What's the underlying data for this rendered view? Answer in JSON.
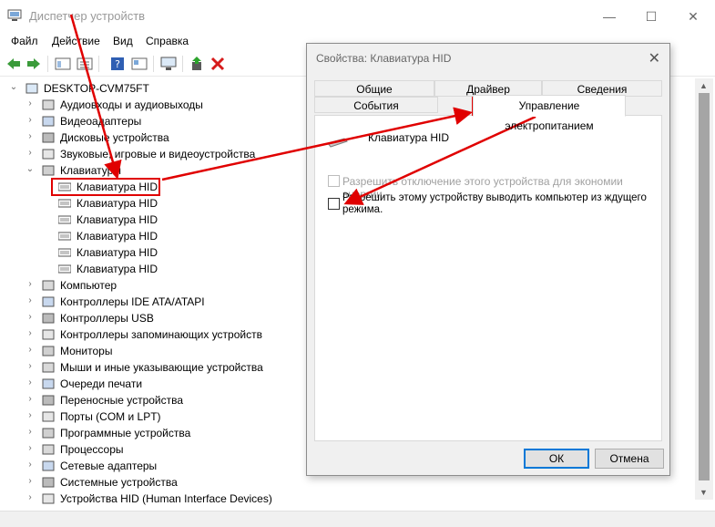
{
  "window": {
    "title": "Диспетчер устройств",
    "controls": {
      "minimize": "—",
      "maximize": "☐",
      "close": "✕"
    }
  },
  "menu": [
    "Файл",
    "Действие",
    "Вид",
    "Справка"
  ],
  "tree": {
    "root": "DESKTOP-CVM75FT",
    "categories": [
      "Аудиовходы и аудиовыходы",
      "Видеоадаптеры",
      "Дисковые устройства",
      "Звуковые, игровые и видеоустройства",
      "Клавиатуры"
    ],
    "keyboards": [
      "Клавиатура HID",
      "Клавиатура HID",
      "Клавиатура HID",
      "Клавиатура HID",
      "Клавиатура HID",
      "Клавиатура HID"
    ],
    "categories_after": [
      "Компьютер",
      "Контроллеры IDE ATA/ATAPI",
      "Контроллеры USB",
      "Контроллеры запоминающих устройств",
      "Мониторы",
      "Мыши и иные указывающие устройства",
      "Очереди печати",
      "Переносные устройства",
      "Порты (COM и LPT)",
      "Программные устройства",
      "Процессоры",
      "Сетевые адаптеры",
      "Системные устройства",
      "Устройства HID (Human Interface Devices)"
    ]
  },
  "dialog": {
    "title": "Свойства: Клавиатура HID",
    "tabs_row1": [
      "Общие",
      "Драйвер",
      "Сведения"
    ],
    "tabs_row2": [
      "События",
      "Управление электропитанием"
    ],
    "device_name": "Клавиатура HID",
    "option1": "Разрешить отключение этого устройства для экономии энергии.",
    "option2": "Разрешить этому устройству выводить компьютер из ждущего режима.",
    "option1_checked": false,
    "option2_checked": false,
    "ok": "ОК",
    "cancel": "Отмена",
    "close": "✕"
  },
  "colors": {
    "annotation": "#e00000",
    "accent": "#0078d7"
  }
}
